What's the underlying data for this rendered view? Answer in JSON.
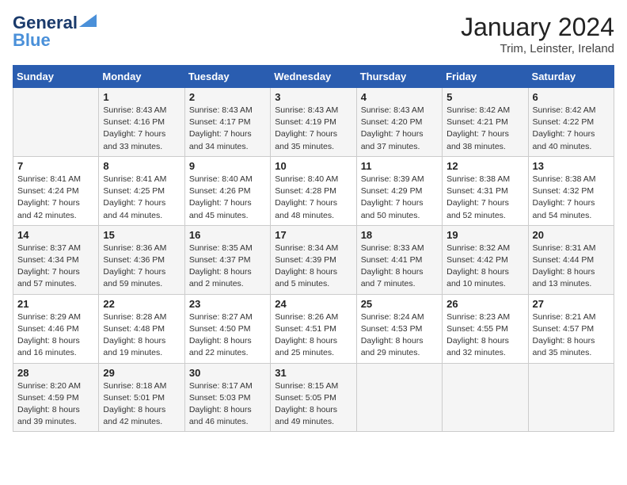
{
  "logo": {
    "line1": "General",
    "line2": "Blue"
  },
  "title": "January 2024",
  "location": "Trim, Leinster, Ireland",
  "days_header": [
    "Sunday",
    "Monday",
    "Tuesday",
    "Wednesday",
    "Thursday",
    "Friday",
    "Saturday"
  ],
  "weeks": [
    [
      {
        "day": "",
        "sunrise": "",
        "sunset": "",
        "daylight": ""
      },
      {
        "day": "1",
        "sunrise": "Sunrise: 8:43 AM",
        "sunset": "Sunset: 4:16 PM",
        "daylight": "Daylight: 7 hours and 33 minutes."
      },
      {
        "day": "2",
        "sunrise": "Sunrise: 8:43 AM",
        "sunset": "Sunset: 4:17 PM",
        "daylight": "Daylight: 7 hours and 34 minutes."
      },
      {
        "day": "3",
        "sunrise": "Sunrise: 8:43 AM",
        "sunset": "Sunset: 4:19 PM",
        "daylight": "Daylight: 7 hours and 35 minutes."
      },
      {
        "day": "4",
        "sunrise": "Sunrise: 8:43 AM",
        "sunset": "Sunset: 4:20 PM",
        "daylight": "Daylight: 7 hours and 37 minutes."
      },
      {
        "day": "5",
        "sunrise": "Sunrise: 8:42 AM",
        "sunset": "Sunset: 4:21 PM",
        "daylight": "Daylight: 7 hours and 38 minutes."
      },
      {
        "day": "6",
        "sunrise": "Sunrise: 8:42 AM",
        "sunset": "Sunset: 4:22 PM",
        "daylight": "Daylight: 7 hours and 40 minutes."
      }
    ],
    [
      {
        "day": "7",
        "sunrise": "Sunrise: 8:41 AM",
        "sunset": "Sunset: 4:24 PM",
        "daylight": "Daylight: 7 hours and 42 minutes."
      },
      {
        "day": "8",
        "sunrise": "Sunrise: 8:41 AM",
        "sunset": "Sunset: 4:25 PM",
        "daylight": "Daylight: 7 hours and 44 minutes."
      },
      {
        "day": "9",
        "sunrise": "Sunrise: 8:40 AM",
        "sunset": "Sunset: 4:26 PM",
        "daylight": "Daylight: 7 hours and 45 minutes."
      },
      {
        "day": "10",
        "sunrise": "Sunrise: 8:40 AM",
        "sunset": "Sunset: 4:28 PM",
        "daylight": "Daylight: 7 hours and 48 minutes."
      },
      {
        "day": "11",
        "sunrise": "Sunrise: 8:39 AM",
        "sunset": "Sunset: 4:29 PM",
        "daylight": "Daylight: 7 hours and 50 minutes."
      },
      {
        "day": "12",
        "sunrise": "Sunrise: 8:38 AM",
        "sunset": "Sunset: 4:31 PM",
        "daylight": "Daylight: 7 hours and 52 minutes."
      },
      {
        "day": "13",
        "sunrise": "Sunrise: 8:38 AM",
        "sunset": "Sunset: 4:32 PM",
        "daylight": "Daylight: 7 hours and 54 minutes."
      }
    ],
    [
      {
        "day": "14",
        "sunrise": "Sunrise: 8:37 AM",
        "sunset": "Sunset: 4:34 PM",
        "daylight": "Daylight: 7 hours and 57 minutes."
      },
      {
        "day": "15",
        "sunrise": "Sunrise: 8:36 AM",
        "sunset": "Sunset: 4:36 PM",
        "daylight": "Daylight: 7 hours and 59 minutes."
      },
      {
        "day": "16",
        "sunrise": "Sunrise: 8:35 AM",
        "sunset": "Sunset: 4:37 PM",
        "daylight": "Daylight: 8 hours and 2 minutes."
      },
      {
        "day": "17",
        "sunrise": "Sunrise: 8:34 AM",
        "sunset": "Sunset: 4:39 PM",
        "daylight": "Daylight: 8 hours and 5 minutes."
      },
      {
        "day": "18",
        "sunrise": "Sunrise: 8:33 AM",
        "sunset": "Sunset: 4:41 PM",
        "daylight": "Daylight: 8 hours and 7 minutes."
      },
      {
        "day": "19",
        "sunrise": "Sunrise: 8:32 AM",
        "sunset": "Sunset: 4:42 PM",
        "daylight": "Daylight: 8 hours and 10 minutes."
      },
      {
        "day": "20",
        "sunrise": "Sunrise: 8:31 AM",
        "sunset": "Sunset: 4:44 PM",
        "daylight": "Daylight: 8 hours and 13 minutes."
      }
    ],
    [
      {
        "day": "21",
        "sunrise": "Sunrise: 8:29 AM",
        "sunset": "Sunset: 4:46 PM",
        "daylight": "Daylight: 8 hours and 16 minutes."
      },
      {
        "day": "22",
        "sunrise": "Sunrise: 8:28 AM",
        "sunset": "Sunset: 4:48 PM",
        "daylight": "Daylight: 8 hours and 19 minutes."
      },
      {
        "day": "23",
        "sunrise": "Sunrise: 8:27 AM",
        "sunset": "Sunset: 4:50 PM",
        "daylight": "Daylight: 8 hours and 22 minutes."
      },
      {
        "day": "24",
        "sunrise": "Sunrise: 8:26 AM",
        "sunset": "Sunset: 4:51 PM",
        "daylight": "Daylight: 8 hours and 25 minutes."
      },
      {
        "day": "25",
        "sunrise": "Sunrise: 8:24 AM",
        "sunset": "Sunset: 4:53 PM",
        "daylight": "Daylight: 8 hours and 29 minutes."
      },
      {
        "day": "26",
        "sunrise": "Sunrise: 8:23 AM",
        "sunset": "Sunset: 4:55 PM",
        "daylight": "Daylight: 8 hours and 32 minutes."
      },
      {
        "day": "27",
        "sunrise": "Sunrise: 8:21 AM",
        "sunset": "Sunset: 4:57 PM",
        "daylight": "Daylight: 8 hours and 35 minutes."
      }
    ],
    [
      {
        "day": "28",
        "sunrise": "Sunrise: 8:20 AM",
        "sunset": "Sunset: 4:59 PM",
        "daylight": "Daylight: 8 hours and 39 minutes."
      },
      {
        "day": "29",
        "sunrise": "Sunrise: 8:18 AM",
        "sunset": "Sunset: 5:01 PM",
        "daylight": "Daylight: 8 hours and 42 minutes."
      },
      {
        "day": "30",
        "sunrise": "Sunrise: 8:17 AM",
        "sunset": "Sunset: 5:03 PM",
        "daylight": "Daylight: 8 hours and 46 minutes."
      },
      {
        "day": "31",
        "sunrise": "Sunrise: 8:15 AM",
        "sunset": "Sunset: 5:05 PM",
        "daylight": "Daylight: 8 hours and 49 minutes."
      },
      {
        "day": "",
        "sunrise": "",
        "sunset": "",
        "daylight": ""
      },
      {
        "day": "",
        "sunrise": "",
        "sunset": "",
        "daylight": ""
      },
      {
        "day": "",
        "sunrise": "",
        "sunset": "",
        "daylight": ""
      }
    ]
  ]
}
